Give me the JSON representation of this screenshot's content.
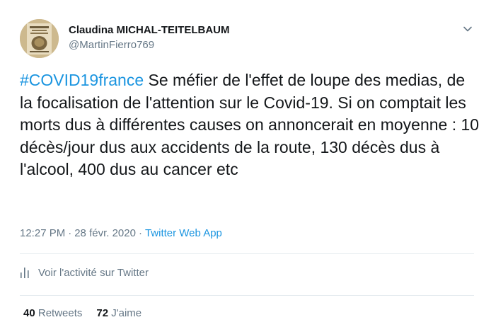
{
  "author": {
    "display_name": "Claudina MICHAL-TEITELBAUM",
    "handle": "@MartinFierro769"
  },
  "tweet": {
    "hashtag": "#COVID19france",
    "body": " Se méfier de l'effet de loupe des medias, de la focalisation de l'attention sur le Covid-19. Si on comptait les morts dus à différentes causes on annoncerait en moyenne : 10 décès/jour dus aux accidents de la route, 130 décès dus à l'alcool, 400 dus au cancer etc"
  },
  "meta": {
    "time": "12:27 PM",
    "date": "28 févr. 2020",
    "separator": "·",
    "source": "Twitter Web App"
  },
  "analytics": {
    "label": "Voir l'activité sur Twitter",
    "icon": "bar-chart-icon"
  },
  "stats": {
    "retweets_count": "40",
    "retweets_label": "Retweets",
    "likes_count": "72",
    "likes_label": "J'aime"
  },
  "colors": {
    "link": "#1b95e0",
    "secondary_text": "#657786",
    "primary_text": "#14171a",
    "divider": "#e6ecf0"
  }
}
